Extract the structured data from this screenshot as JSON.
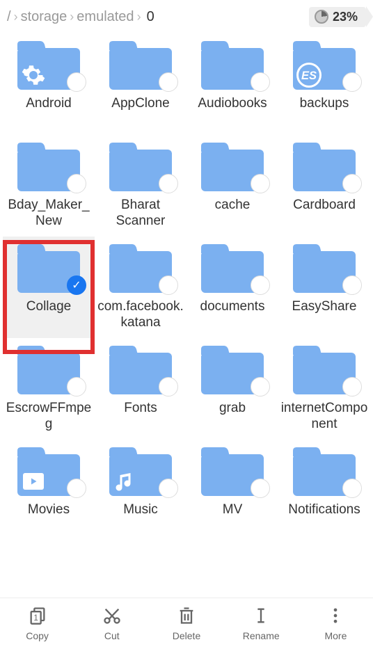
{
  "breadcrumb": {
    "root": "/",
    "seg1": "storage",
    "seg2": "emulated",
    "seg3": "0"
  },
  "storage": {
    "percent_label": "23%"
  },
  "folders": [
    {
      "name": "Android",
      "overlay": "gear",
      "selected": false
    },
    {
      "name": "AppClone",
      "overlay": null,
      "selected": false
    },
    {
      "name": "Audiobooks",
      "overlay": null,
      "selected": false
    },
    {
      "name": "backups",
      "overlay": "es-logo",
      "selected": false
    },
    {
      "name": "Bday_Maker_New",
      "overlay": null,
      "selected": false
    },
    {
      "name": "Bharat Scanner",
      "overlay": null,
      "selected": false
    },
    {
      "name": "cache",
      "overlay": null,
      "selected": false
    },
    {
      "name": "Cardboard",
      "overlay": null,
      "selected": false
    },
    {
      "name": "Collage",
      "overlay": null,
      "selected": true
    },
    {
      "name": "com.facebook.katana",
      "overlay": null,
      "selected": false
    },
    {
      "name": "documents",
      "overlay": null,
      "selected": false
    },
    {
      "name": "EasyShare",
      "overlay": null,
      "selected": false
    },
    {
      "name": "EscrowFFmpeg",
      "overlay": null,
      "selected": false
    },
    {
      "name": "Fonts",
      "overlay": null,
      "selected": false
    },
    {
      "name": "grab",
      "overlay": null,
      "selected": false
    },
    {
      "name": "internetComponent",
      "overlay": null,
      "selected": false
    },
    {
      "name": "Movies",
      "overlay": "play",
      "selected": false
    },
    {
      "name": "Music",
      "overlay": "music",
      "selected": false
    },
    {
      "name": "MV",
      "overlay": null,
      "selected": false
    },
    {
      "name": "Notifications",
      "overlay": null,
      "selected": false
    }
  ],
  "actions": {
    "copy": "Copy",
    "cut": "Cut",
    "delete": "Delete",
    "rename": "Rename",
    "more": "More"
  },
  "copy_badge": "1"
}
